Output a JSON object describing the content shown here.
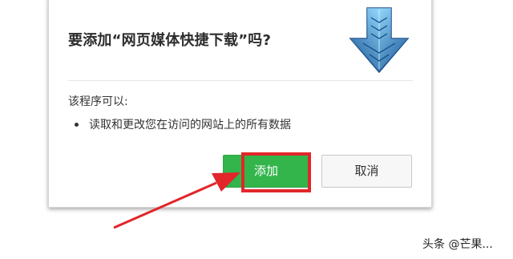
{
  "dialog": {
    "title": "要添加“网页媒体快捷下载”吗?",
    "permissions_heading": "该程序可以:",
    "permissions": [
      "读取和更改您在访问的网站上的所有数据"
    ],
    "add_button": "添加",
    "cancel_button": "取消",
    "icon": "download-arrow-icon"
  },
  "annotation": {
    "highlight_color": "#e2262a",
    "arrow_color": "#e2262a"
  },
  "watermark": {
    "text": "头条 @芒果..."
  },
  "colors": {
    "add_button_bg": "#33b54c",
    "icon_blue_light": "#6fc3f2",
    "icon_blue_dark": "#1c5fa8"
  }
}
